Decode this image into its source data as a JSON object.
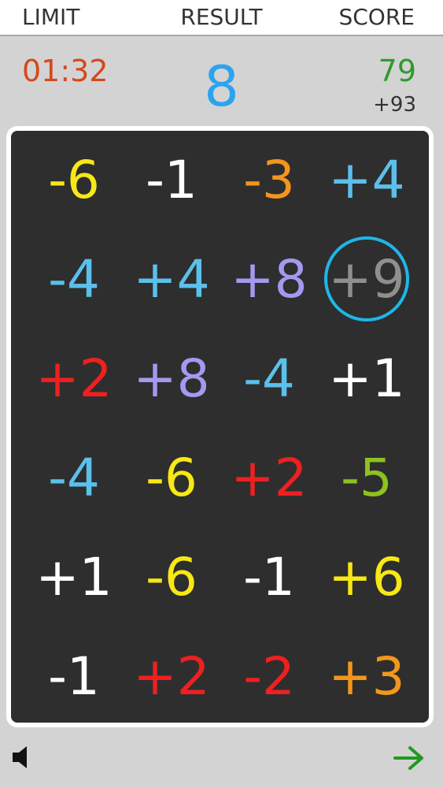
{
  "header": {
    "limit_label": "LIMIT",
    "result_label": "RESULT",
    "score_label": "SCORE"
  },
  "status": {
    "time_limit": "01:32",
    "result": "8",
    "score": "79",
    "bonus": "+93"
  },
  "board": {
    "columns": 4,
    "selected_index": 7,
    "tiles": [
      {
        "text": "-6",
        "color": "#f7e816"
      },
      {
        "text": "-1",
        "color": "#ffffff"
      },
      {
        "text": "-3",
        "color": "#f4961c"
      },
      {
        "text": "+4",
        "color": "#5bc0eb"
      },
      {
        "text": "-4",
        "color": "#5bc0eb"
      },
      {
        "text": "+4",
        "color": "#5bc0eb"
      },
      {
        "text": "+8",
        "color": "#a29af0"
      },
      {
        "text": "+9",
        "color": "#8f8f8f"
      },
      {
        "text": "+2",
        "color": "#ee2020"
      },
      {
        "text": "+8",
        "color": "#a29af0"
      },
      {
        "text": "-4",
        "color": "#5bc0eb"
      },
      {
        "text": "+1",
        "color": "#ffffff"
      },
      {
        "text": "-4",
        "color": "#5bc0eb"
      },
      {
        "text": "-6",
        "color": "#f7e816"
      },
      {
        "text": "+2",
        "color": "#ee2020"
      },
      {
        "text": "-5",
        "color": "#8dc21f"
      },
      {
        "text": "+1",
        "color": "#ffffff"
      },
      {
        "text": "-6",
        "color": "#f7e816"
      },
      {
        "text": "-1",
        "color": "#ffffff"
      },
      {
        "text": "+6",
        "color": "#f7e816"
      },
      {
        "text": "-1",
        "color": "#ffffff"
      },
      {
        "text": "+2",
        "color": "#ee2020"
      },
      {
        "text": "-2",
        "color": "#ee2020"
      },
      {
        "text": "+3",
        "color": "#f4961c"
      }
    ]
  },
  "controls": {
    "sound_icon": "speaker-icon",
    "next_icon": "arrow-right-icon",
    "next_color": "#1e9a1e"
  }
}
